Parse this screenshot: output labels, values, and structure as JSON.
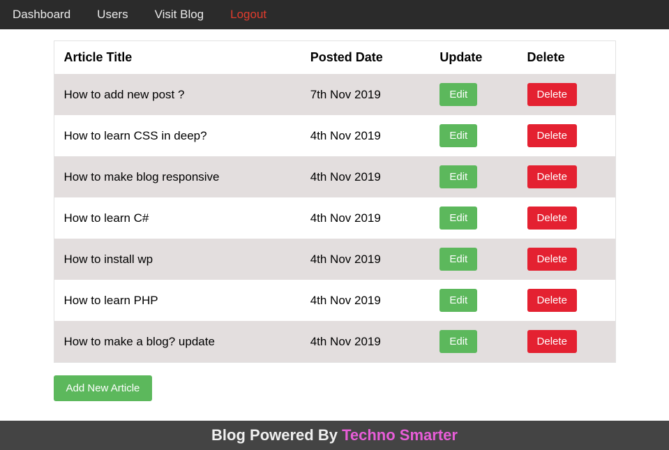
{
  "nav": {
    "dashboard": "Dashboard",
    "users": "Users",
    "visit_blog": "Visit Blog",
    "logout": "Logout"
  },
  "table": {
    "headers": {
      "title": "Article Title",
      "date": "Posted Date",
      "update": "Update",
      "delete": "Delete"
    },
    "edit_label": "Edit",
    "delete_label": "Delete",
    "rows": [
      {
        "title": "How to add new post ?",
        "date": "7th Nov 2019"
      },
      {
        "title": "How to learn CSS in deep?",
        "date": "4th Nov 2019"
      },
      {
        "title": "How to make blog responsive",
        "date": "4th Nov 2019"
      },
      {
        "title": "How to learn C#",
        "date": "4th Nov 2019"
      },
      {
        "title": "How to install wp",
        "date": "4th Nov 2019"
      },
      {
        "title": "How to learn PHP",
        "date": "4th Nov 2019"
      },
      {
        "title": "How to make a blog? update",
        "date": "4th Nov 2019"
      }
    ]
  },
  "add_button": "Add New Article",
  "footer": {
    "prefix": "Blog Powered By ",
    "brand": "Techno Smarter"
  }
}
